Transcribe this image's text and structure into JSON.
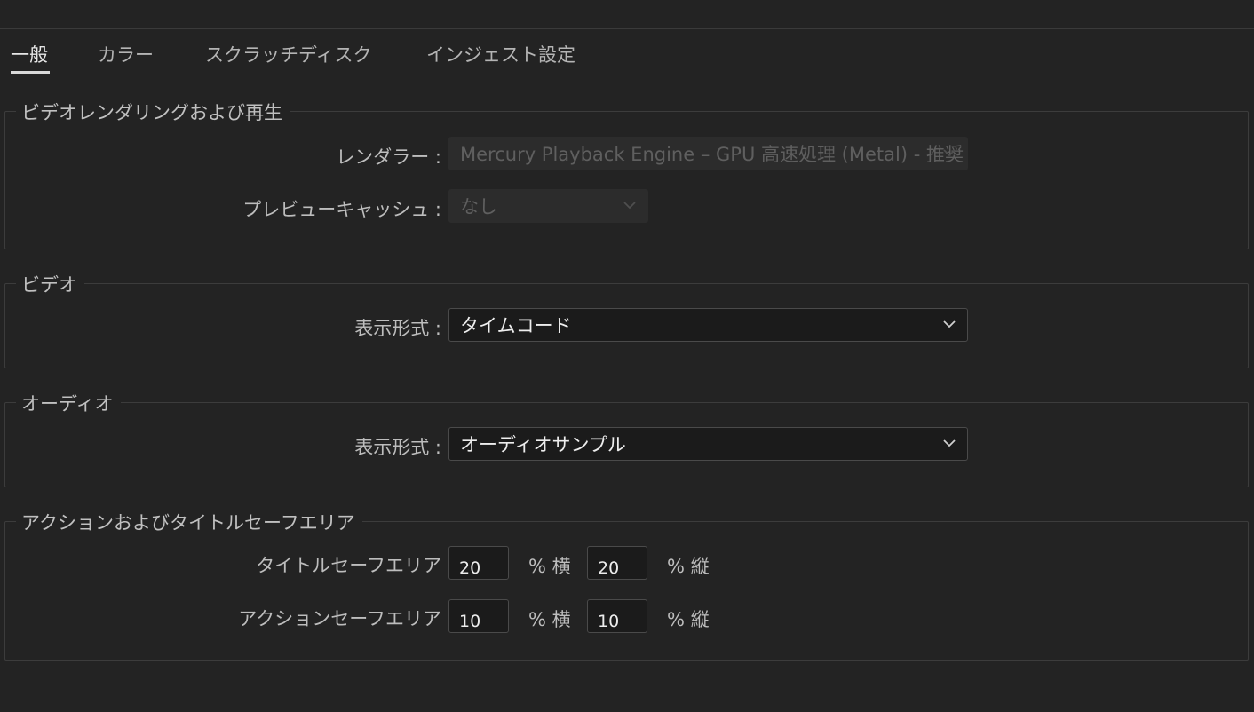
{
  "tabs": [
    {
      "label": "一般",
      "active": true
    },
    {
      "label": "カラー",
      "active": false
    },
    {
      "label": "スクラッチディスク",
      "active": false
    },
    {
      "label": "インジェスト設定",
      "active": false
    }
  ],
  "rendering": {
    "title": "ビデオレンダリングおよび再生",
    "renderer_label": "レンダラー :",
    "renderer_value": "Mercury Playback Engine – GPU 高速処理 (Metal) - 推奨",
    "preview_cache_label": "プレビューキャッシュ :",
    "preview_cache_value": "なし"
  },
  "video": {
    "title": "ビデオ",
    "display_format_label": "表示形式 :",
    "display_format_value": "タイムコード"
  },
  "audio": {
    "title": "オーディオ",
    "display_format_label": "表示形式 :",
    "display_format_value": "オーディオサンプル"
  },
  "safe_area": {
    "title": "アクションおよびタイトルセーフエリア",
    "title_safe_label": "タイトルセーフエリア",
    "title_safe_h": "20",
    "title_safe_v": "20",
    "action_safe_label": "アクションセーフエリア",
    "action_safe_h": "10",
    "action_safe_v": "10",
    "unit_h": "% 横",
    "unit_v": "% 縦"
  },
  "icons": {
    "dropdown": "chevron-down-icon"
  },
  "colors": {
    "background": "#232323",
    "field": "#1b1b1b",
    "disabled_field": "#2c2c2c",
    "border": "#3c3c3c"
  }
}
